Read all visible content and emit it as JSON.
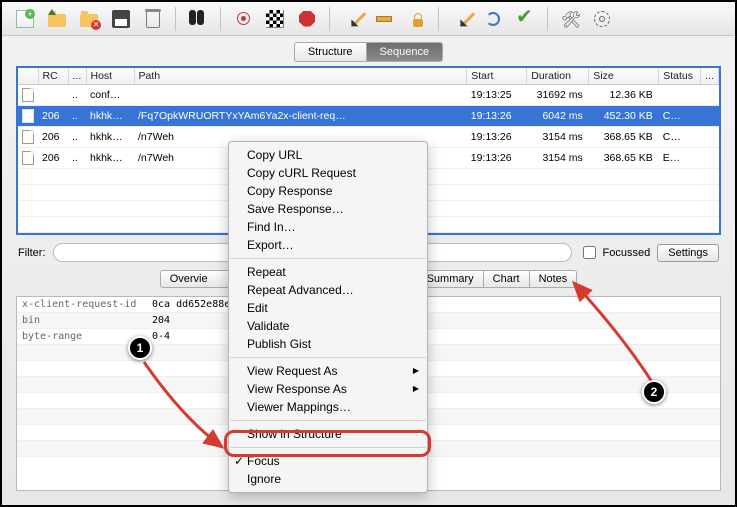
{
  "tabs": {
    "structure": "Structure",
    "sequence": "Sequence"
  },
  "table": {
    "headers": {
      "blank": "",
      "rc": "RC",
      "dots": "...",
      "host": "Host",
      "path": "Path",
      "start": "Start",
      "duration": "Duration",
      "size": "Size",
      "status": "Status",
      "last": "..."
    },
    "rows": [
      {
        "rc": "",
        "host": "conf…",
        "path": "",
        "start": "19:13:25",
        "duration": "31692 ms",
        "size": "12.36 KB",
        "status": ""
      },
      {
        "rc": "206",
        "host": "hkhk…",
        "path": "/Fq7OpkWRUORTYxYAm6Ya2x-client-req…",
        "start": "19:13:26",
        "duration": "6042 ms",
        "size": "452.30 KB",
        "status": "C…",
        "sel": true
      },
      {
        "rc": "206",
        "host": "hkhk…",
        "path": "/n7Weh",
        "start": "19:13:26",
        "duration": "3154 ms",
        "size": "368.65 KB",
        "status": "C…"
      },
      {
        "rc": "206",
        "host": "hkhk…",
        "path": "/n7Weh",
        "start": "19:13:26",
        "duration": "3154 ms",
        "size": "368.65 KB",
        "status": "E…"
      }
    ]
  },
  "filter": {
    "label": "Filter:",
    "placeholder": "",
    "focussed": "Focussed",
    "settings": "Settings"
  },
  "subtabs": {
    "overview": "Overvie",
    "summary": "Summary",
    "chart": "Chart",
    "notes": "Notes"
  },
  "kv": [
    {
      "k": "x-client-request-id",
      "v": "0ca                                        dd652e88e"
    },
    {
      "k": "bin",
      "v": "204"
    },
    {
      "k": "byte-range",
      "v": "0-4"
    }
  ],
  "menu": {
    "copy_url": "Copy URL",
    "copy_curl": "Copy cURL Request",
    "copy_resp": "Copy Response",
    "save_resp": "Save Response…",
    "find": "Find In…",
    "export": "Export…",
    "repeat": "Repeat",
    "repeat_adv": "Repeat Advanced…",
    "edit": "Edit",
    "validate": "Validate",
    "gist": "Publish Gist",
    "view_req": "View Request As",
    "view_resp": "View Response As",
    "vmappings": "Viewer Mappings…",
    "show_struct": "Show in Structure",
    "focus": "Focus",
    "ignore": "Ignore"
  },
  "callouts": {
    "one": "1",
    "two": "2"
  },
  "dots": "..",
  "htxt": ".."
}
